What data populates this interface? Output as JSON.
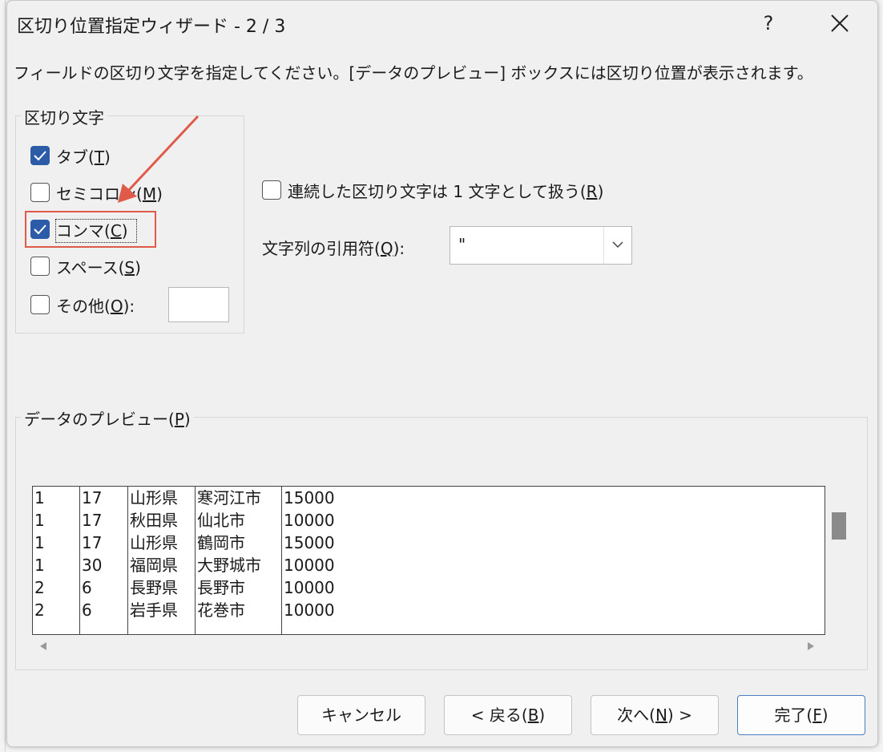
{
  "dialog": {
    "title": "区切り位置指定ウィザード - 2 / 3",
    "help_label": "?",
    "instruction": "フィールドの区切り文字を指定してください。[データのプレビュー] ボックスには区切り位置が表示されます。"
  },
  "delimiters": {
    "group_label": "区切り文字",
    "tab": {
      "label": "タブ(",
      "key": "T",
      "suffix": ")",
      "checked": true
    },
    "semicolon": {
      "label": "セミコロン(",
      "key": "M",
      "suffix": ")",
      "checked": false
    },
    "comma": {
      "label": "コンマ(",
      "key": "C",
      "suffix": ")",
      "checked": true
    },
    "space": {
      "label": "スペース(",
      "key": "S",
      "suffix": ")",
      "checked": false
    },
    "other": {
      "label": "その他(",
      "key": "O",
      "suffix": "):",
      "checked": false,
      "value": ""
    }
  },
  "consecutive": {
    "label": "連続した区切り文字は 1 文字として扱う(",
    "key": "R",
    "suffix": ")",
    "checked": false
  },
  "text_qualifier": {
    "label": "文字列の引用符(",
    "key": "Q",
    "suffix": "):",
    "value": "\""
  },
  "preview": {
    "group_label": "データのプレビュー(",
    "key": "P",
    "suffix": ")",
    "rows": [
      [
        "1",
        "17",
        "山形県",
        "寒河江市",
        "15000"
      ],
      [
        "1",
        "17",
        "秋田県",
        "仙北市",
        "10000"
      ],
      [
        "1",
        "17",
        "山形県",
        "鶴岡市",
        "15000"
      ],
      [
        "1",
        "30",
        "福岡県",
        "大野城市",
        "10000"
      ],
      [
        "2",
        "6",
        "長野県",
        "長野市",
        "10000"
      ],
      [
        "2",
        "6",
        "岩手県",
        "花巻市",
        "10000"
      ]
    ]
  },
  "buttons": {
    "cancel": "キャンセル",
    "back": {
      "label": "< 戻る(",
      "key": "B",
      "suffix": ")"
    },
    "next": {
      "label": "次へ(",
      "key": "N",
      "suffix": ") >"
    },
    "finish": {
      "label": "完了(",
      "key": "F",
      "suffix": ")"
    }
  },
  "colors": {
    "checkbox_checked": "#2c5ba8",
    "annotation": "#e05a4a",
    "primary_border": "#4a7fc1"
  }
}
